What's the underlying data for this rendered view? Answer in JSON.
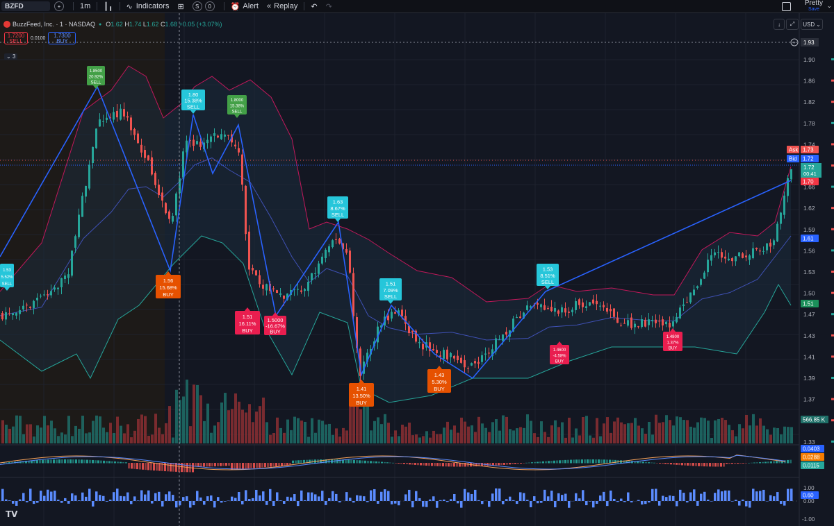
{
  "toolbar": {
    "symbol": "BZFD",
    "interval": "1m",
    "indicators_label": "Indicators",
    "alert_label": "Alert",
    "replay_label": "Replay",
    "layout_label": "Pretty",
    "save_label": "Save"
  },
  "header": {
    "title": "BuzzFeed, Inc. · 1 · NASDAQ",
    "o_label": "O",
    "o_value": "1.62",
    "h_label": "H",
    "h_value": "1.74",
    "l_label": "L",
    "l_value": "1.62",
    "c_label": "C",
    "c_value": "1.68",
    "change": "+0.05 (+3.07%)",
    "sell_price": "1.7200",
    "sell_label": "SELL",
    "buy_price": "1.7300",
    "buy_label": "BUY",
    "spread": "0.0100",
    "indicators_count": "3",
    "currency": "USD"
  },
  "price_axis": {
    "ticks": [
      "1.90",
      "1.86",
      "1.82",
      "1.78",
      "1.74",
      "1.70",
      "1.66",
      "1.62",
      "1.59",
      "1.56",
      "1.53",
      "1.50",
      "1.47",
      "1.43",
      "1.41",
      "1.39",
      "1.37",
      "1.35",
      "1.33"
    ],
    "crosshair_price": "1.93",
    "ask_label": "Ask",
    "ask_value": "1.73",
    "bid_label": "Bid",
    "bid_value": "1.72",
    "last_value": "1.72",
    "countdown": "00:41",
    "low_value": "1.70",
    "ma_value": "1.61",
    "lower_band_value": "1.51",
    "volume_value": "566.85 K"
  },
  "macd_axis": {
    "v1": "0.0403",
    "v2": "0.0288",
    "v3": "0.0115"
  },
  "osc_axis": {
    "top": "1.00",
    "value": "0.60",
    "zero": "0.00",
    "bottom": "-1.00"
  },
  "signals": [
    {
      "kind": "sell",
      "color": "#43a047",
      "lines": [
        "1.8500",
        "20.92%",
        "SELL"
      ]
    },
    {
      "kind": "sell",
      "color": "#26c6da",
      "lines": [
        "1.80",
        "15.38%",
        "SELL"
      ]
    },
    {
      "kind": "sell",
      "color": "#43a047",
      "lines": [
        "1.8000",
        "15.38%",
        "SELL"
      ]
    },
    {
      "kind": "sell",
      "color": "#26c6da",
      "lines": [
        "1.63",
        "8.67%",
        "SELL"
      ]
    },
    {
      "kind": "sell",
      "color": "#26c6da",
      "lines": [
        "1.51",
        "7.09%",
        "SELL"
      ]
    },
    {
      "kind": "sell",
      "color": "#26c6da",
      "lines": [
        "1.53",
        "8.51%",
        "SELL"
      ]
    },
    {
      "kind": "sell",
      "color": "#26c6da",
      "lines": [
        "1.53",
        "5.52%",
        "SELL"
      ]
    },
    {
      "kind": "buy",
      "color": "#e65100",
      "lines": [
        "1.56",
        "15.68%",
        "BUY"
      ]
    },
    {
      "kind": "buy",
      "color": "#e91e4f",
      "lines": [
        "1.51",
        "16.11%",
        "BUY"
      ]
    },
    {
      "kind": "buy",
      "color": "#e91e4f",
      "lines": [
        "1.5000",
        "-16.67%",
        "BUY"
      ]
    },
    {
      "kind": "buy",
      "color": "#e65100",
      "lines": [
        "1.41",
        "13.50%",
        "BUY"
      ]
    },
    {
      "kind": "buy",
      "color": "#e65100",
      "lines": [
        "1.43",
        "5.30%",
        "BUY"
      ]
    },
    {
      "kind": "buy",
      "color": "#e91e4f",
      "lines": [
        "1.4600",
        "-4.58%",
        "BUY"
      ]
    },
    {
      "kind": "buy",
      "color": "#e91e4f",
      "lines": [
        "1.4800",
        "1.37%",
        "BUY"
      ]
    }
  ],
  "colors": {
    "up": "#26a69a",
    "down": "#ef5350",
    "zigzag": "#2962ff",
    "upper_band": "#c2185b",
    "lower_band": "#26a69a",
    "bg": "#131722"
  }
}
